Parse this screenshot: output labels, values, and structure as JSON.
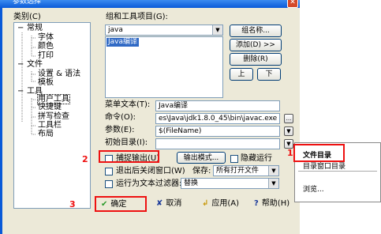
{
  "window": {
    "title": "参数选择",
    "close_glyph": "✕"
  },
  "left": {
    "category_label": "类别(C)",
    "tree": {
      "expander": "−",
      "items": [
        "常规",
        "字体",
        "颜色",
        "打印",
        "文件",
        "设置 & 语法",
        "模板",
        "工具",
        "用户工具",
        "快捷键",
        "拼写检查",
        "工具栏",
        "布局"
      ]
    }
  },
  "tools": {
    "group_label": "组和工具项目(G):",
    "group_value": "java",
    "list_item": "Java编译",
    "group_name_button": "组名称...",
    "add_button": "添加(D) >>",
    "delete_button": "删除(R)",
    "up_button": "上",
    "down_button": "下"
  },
  "fields": {
    "menu_text_label": "菜单文本(T):",
    "menu_text_value": "Java编译",
    "command_label": "命令(O):",
    "command_value": "es\\Java\\jdk1.8.0_45\\bin\\javac.exe",
    "browse_glyph": "...",
    "params_label": "参数(E):",
    "params_value": "$(FileName)",
    "initial_dir_label": "初始目录(I):",
    "dropdown_glyph": "▼"
  },
  "options": {
    "capture_output": "捕捉输出(U)",
    "output_mode_button": "输出模式...",
    "hide_run": "隐藏运行",
    "close_window": "退出后关闭窗口(W)",
    "save_label": "保存:",
    "save_value": "所有打开文件",
    "run_as_filter": "运行为文本过滤器:",
    "filter_value": "替换"
  },
  "context_menu": {
    "items": [
      "文件目录",
      "目录窗口目录",
      "浏览..."
    ]
  },
  "buttons": {
    "ok_icon": "✔",
    "ok": "确定",
    "cancel_icon": "✘",
    "cancel": "取消",
    "apply_icon": "↲",
    "apply": "应用(A)",
    "help_icon": "?",
    "help": "帮助(H)"
  },
  "annotations": [
    "1",
    "2",
    "3"
  ],
  "colors": {
    "annotation_red": "#ee1111",
    "selection_blue": "#316ac5",
    "title_blue": "#0a5ad8"
  }
}
